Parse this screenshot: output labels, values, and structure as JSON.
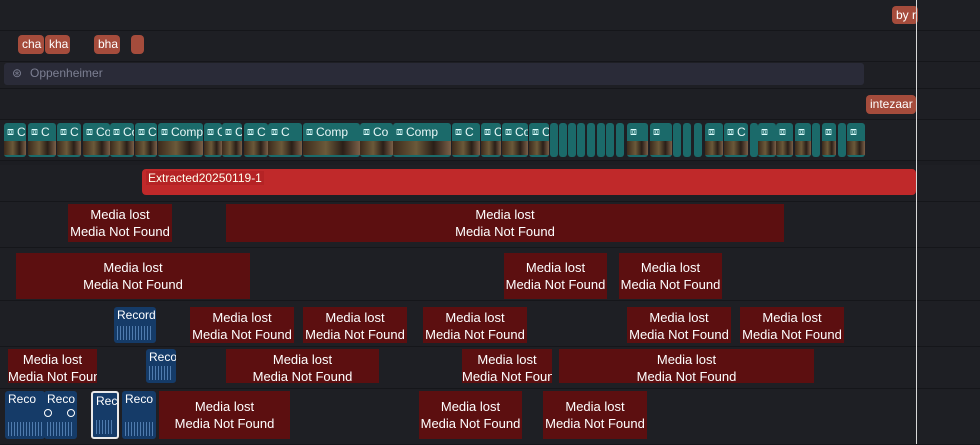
{
  "tracks": {
    "text_top": {
      "tags": [
        "by r"
      ]
    },
    "text_tags": {
      "tags": [
        "cha",
        "kha",
        "bha",
        ""
      ]
    },
    "adjustment": {
      "icon": "adjustment-layer-icon",
      "label": "Oppenheimer"
    },
    "text_mid": {
      "tags": [
        "intezaar"
      ]
    },
    "compound": {
      "label_full": "Comp",
      "label_short": "Co",
      "label_c": "C",
      "icon": "compound-clip-icon"
    },
    "extracted": {
      "label": "Extracted20250119-1"
    },
    "media_lost": {
      "line1": "Media lost",
      "line2": "Media Not Found"
    },
    "recording": {
      "label": "Record",
      "label_short": "Reco"
    }
  },
  "colors": {
    "text_tag": "#a54c3c",
    "compound": "#1b6a6a",
    "extracted": "#c0292a",
    "media_lost": "#5c0f10",
    "recording": "#153b68",
    "playhead": "#d8d8d8"
  }
}
